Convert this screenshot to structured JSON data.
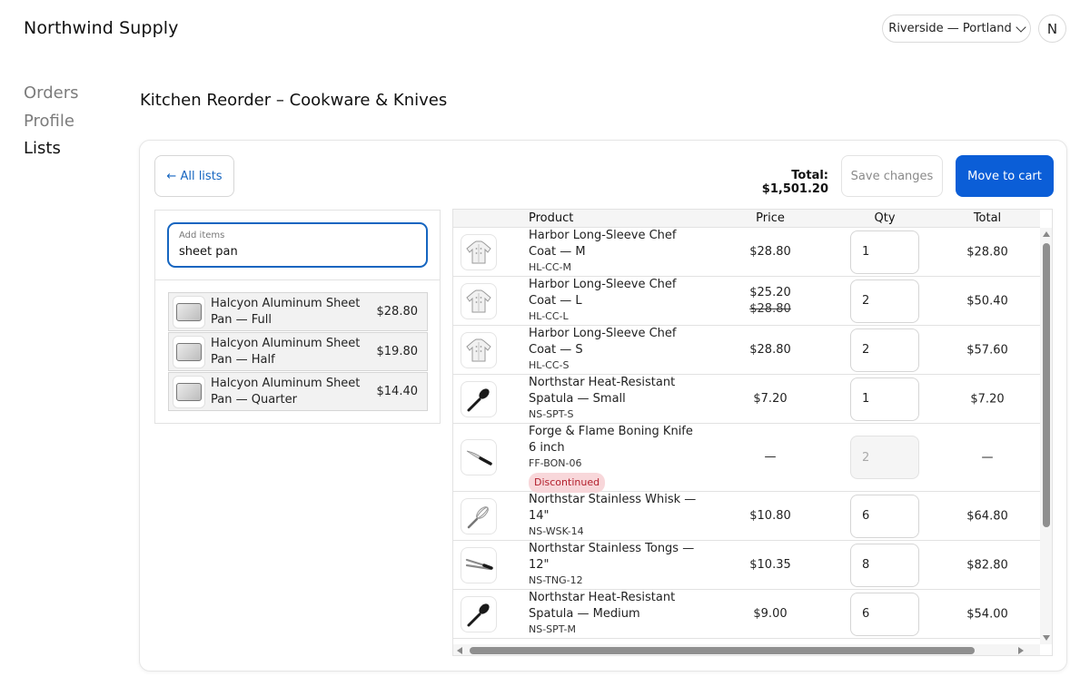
{
  "header": {
    "brand": "Northwind Supply",
    "location": "Riverside — Portland",
    "avatar_initial": "N"
  },
  "nav": {
    "items": [
      {
        "label": "Orders",
        "active": false
      },
      {
        "label": "Profile",
        "active": false
      },
      {
        "label": "Lists",
        "active": true
      }
    ]
  },
  "page": {
    "title": "Kitchen Reorder – Cookware & Knives"
  },
  "toolbar": {
    "back_label": "← All lists",
    "total_label": "Total: $1,501.20",
    "save_label": "Save changes",
    "cart_label": "Move to cart"
  },
  "search": {
    "label": "Add items",
    "value": "sheet pan"
  },
  "suggestions": [
    {
      "name": "Halcyon Aluminum Sheet Pan — Full",
      "price": "$28.80"
    },
    {
      "name": "Halcyon Aluminum Sheet Pan — Half",
      "price": "$19.80"
    },
    {
      "name": "Halcyon Aluminum Sheet Pan — Quarter",
      "price": "$14.40"
    }
  ],
  "table": {
    "columns": {
      "product": "Product",
      "price": "Price",
      "qty": "Qty",
      "total": "Total"
    },
    "rows": [
      {
        "name": "Harbor Long-Sleeve Chef Coat — M",
        "sku": "HL-CC-M",
        "price": "$28.80",
        "old_price": "",
        "qty": "1",
        "total": "$28.80",
        "badge": "",
        "icon": "chef-coat-icon",
        "disabled": false
      },
      {
        "name": "Harbor Long-Sleeve Chef Coat — L",
        "sku": "HL-CC-L",
        "price": "$25.20",
        "old_price": "$28.80",
        "qty": "2",
        "total": "$50.40",
        "badge": "",
        "icon": "chef-coat-icon",
        "disabled": false
      },
      {
        "name": "Harbor Long-Sleeve Chef Coat — S",
        "sku": "HL-CC-S",
        "price": "$28.80",
        "old_price": "",
        "qty": "2",
        "total": "$57.60",
        "badge": "",
        "icon": "chef-coat-icon",
        "disabled": false
      },
      {
        "name": "Northstar Heat-Resistant Spatula — Small",
        "sku": "NS-SPT-S",
        "price": "$7.20",
        "old_price": "",
        "qty": "1",
        "total": "$7.20",
        "badge": "",
        "icon": "spatula-icon",
        "disabled": false
      },
      {
        "name": "Forge & Flame Boning Knife 6 inch",
        "sku": "FF-BON-06",
        "price": "—",
        "old_price": "",
        "qty": "2",
        "total": "—",
        "badge": "Discontinued",
        "icon": "knife-icon",
        "disabled": true
      },
      {
        "name": "Northstar Stainless Whisk — 14\"",
        "sku": "NS-WSK-14",
        "price": "$10.80",
        "old_price": "",
        "qty": "6",
        "total": "$64.80",
        "badge": "",
        "icon": "whisk-icon",
        "disabled": false
      },
      {
        "name": "Northstar Stainless Tongs — 12\"",
        "sku": "NS-TNG-12",
        "price": "$10.35",
        "old_price": "",
        "qty": "8",
        "total": "$82.80",
        "badge": "",
        "icon": "tongs-icon",
        "disabled": false
      },
      {
        "name": "Northstar Heat-Resistant Spatula — Medium",
        "sku": "NS-SPT-M",
        "price": "$9.00",
        "old_price": "",
        "qty": "6",
        "total": "$54.00",
        "badge": "",
        "icon": "spatula-icon",
        "disabled": false
      }
    ]
  },
  "colors": {
    "accent": "#0b5ed7",
    "link": "#1565c0",
    "badge_bg": "#f8d7da",
    "badge_text": "#b3202d"
  }
}
